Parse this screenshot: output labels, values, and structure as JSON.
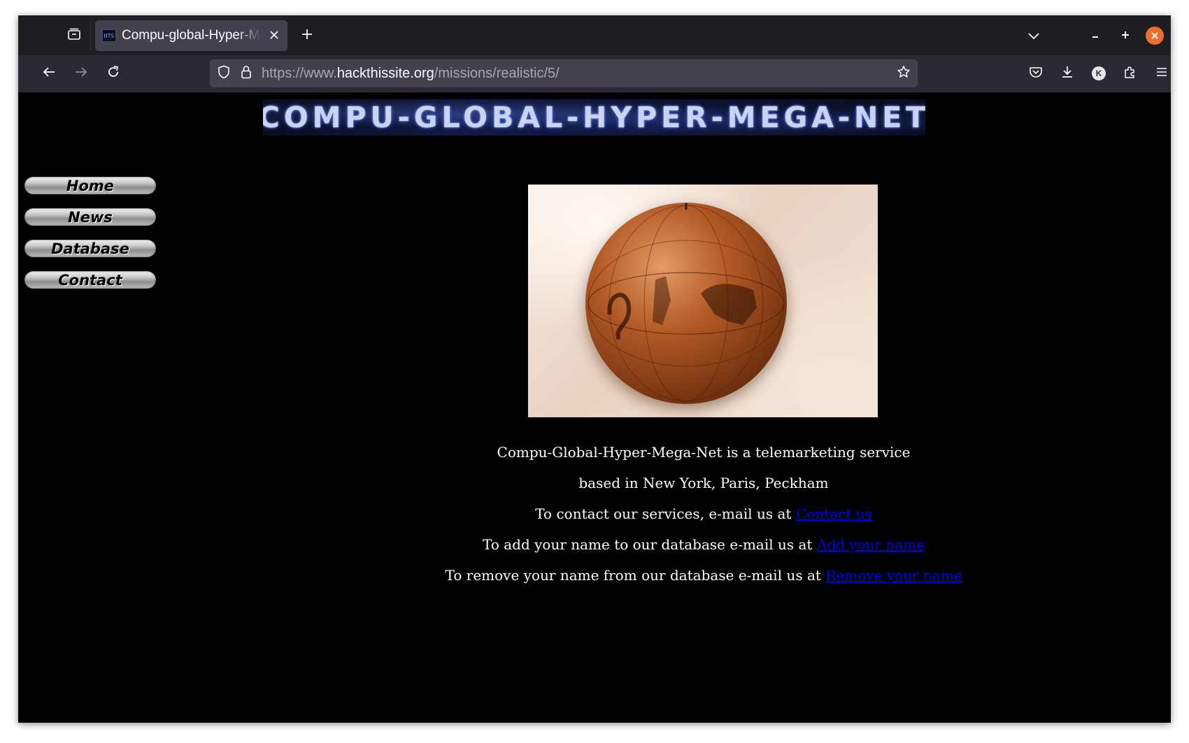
{
  "browser": {
    "tab": {
      "title": "Compu-global-Hyper-Mega-Net",
      "favicon_text": "HTS"
    },
    "url": {
      "scheme": "https://www.",
      "host": "hackthissite.org",
      "path": "/missions/realistic/5/"
    },
    "account_initial": "K",
    "icons": {
      "tab_list": "folder-tabs-icon",
      "close_tab": "close-icon",
      "new_tab": "plus-icon",
      "list_all_tabs": "chevron-down-icon",
      "minimize": "minimize-icon",
      "maximize": "maximize-icon",
      "close_window": "close-icon",
      "back": "arrow-left-icon",
      "forward": "arrow-right-icon",
      "reload": "reload-icon",
      "tracking_protection": "shield-icon",
      "lock": "lock-icon",
      "bookmark": "star-icon",
      "pocket": "pocket-icon",
      "downloads": "download-icon",
      "extensions": "puzzle-icon",
      "menu": "hamburger-menu-icon"
    },
    "colors": {
      "tabbar": "#1f1e23",
      "navbar": "#2b2a33",
      "active_tab": "#42414d",
      "close_window": "#e9712c"
    }
  },
  "page": {
    "banner": "COMPU-GLOBAL-HYPER-MEGA-NET",
    "nav": [
      "Home",
      "News",
      "Database",
      "Contact"
    ],
    "lines": {
      "l1": "Compu-Global-Hyper-Mega-Net is a telemarketing service",
      "l2": "based in New York, Paris, Peckham",
      "l3_text": "To contact our services, e-mail us at ",
      "l3_link": "Contact us",
      "l4_text": "To add your name to our database e-mail us at ",
      "l4_link": "Add your name",
      "l5_text": "To remove your name from our database e-mail us at ",
      "l5_link": "Remove your name"
    },
    "colors": {
      "background": "#000000",
      "text": "#ffffff",
      "link": "#0000ee"
    }
  }
}
